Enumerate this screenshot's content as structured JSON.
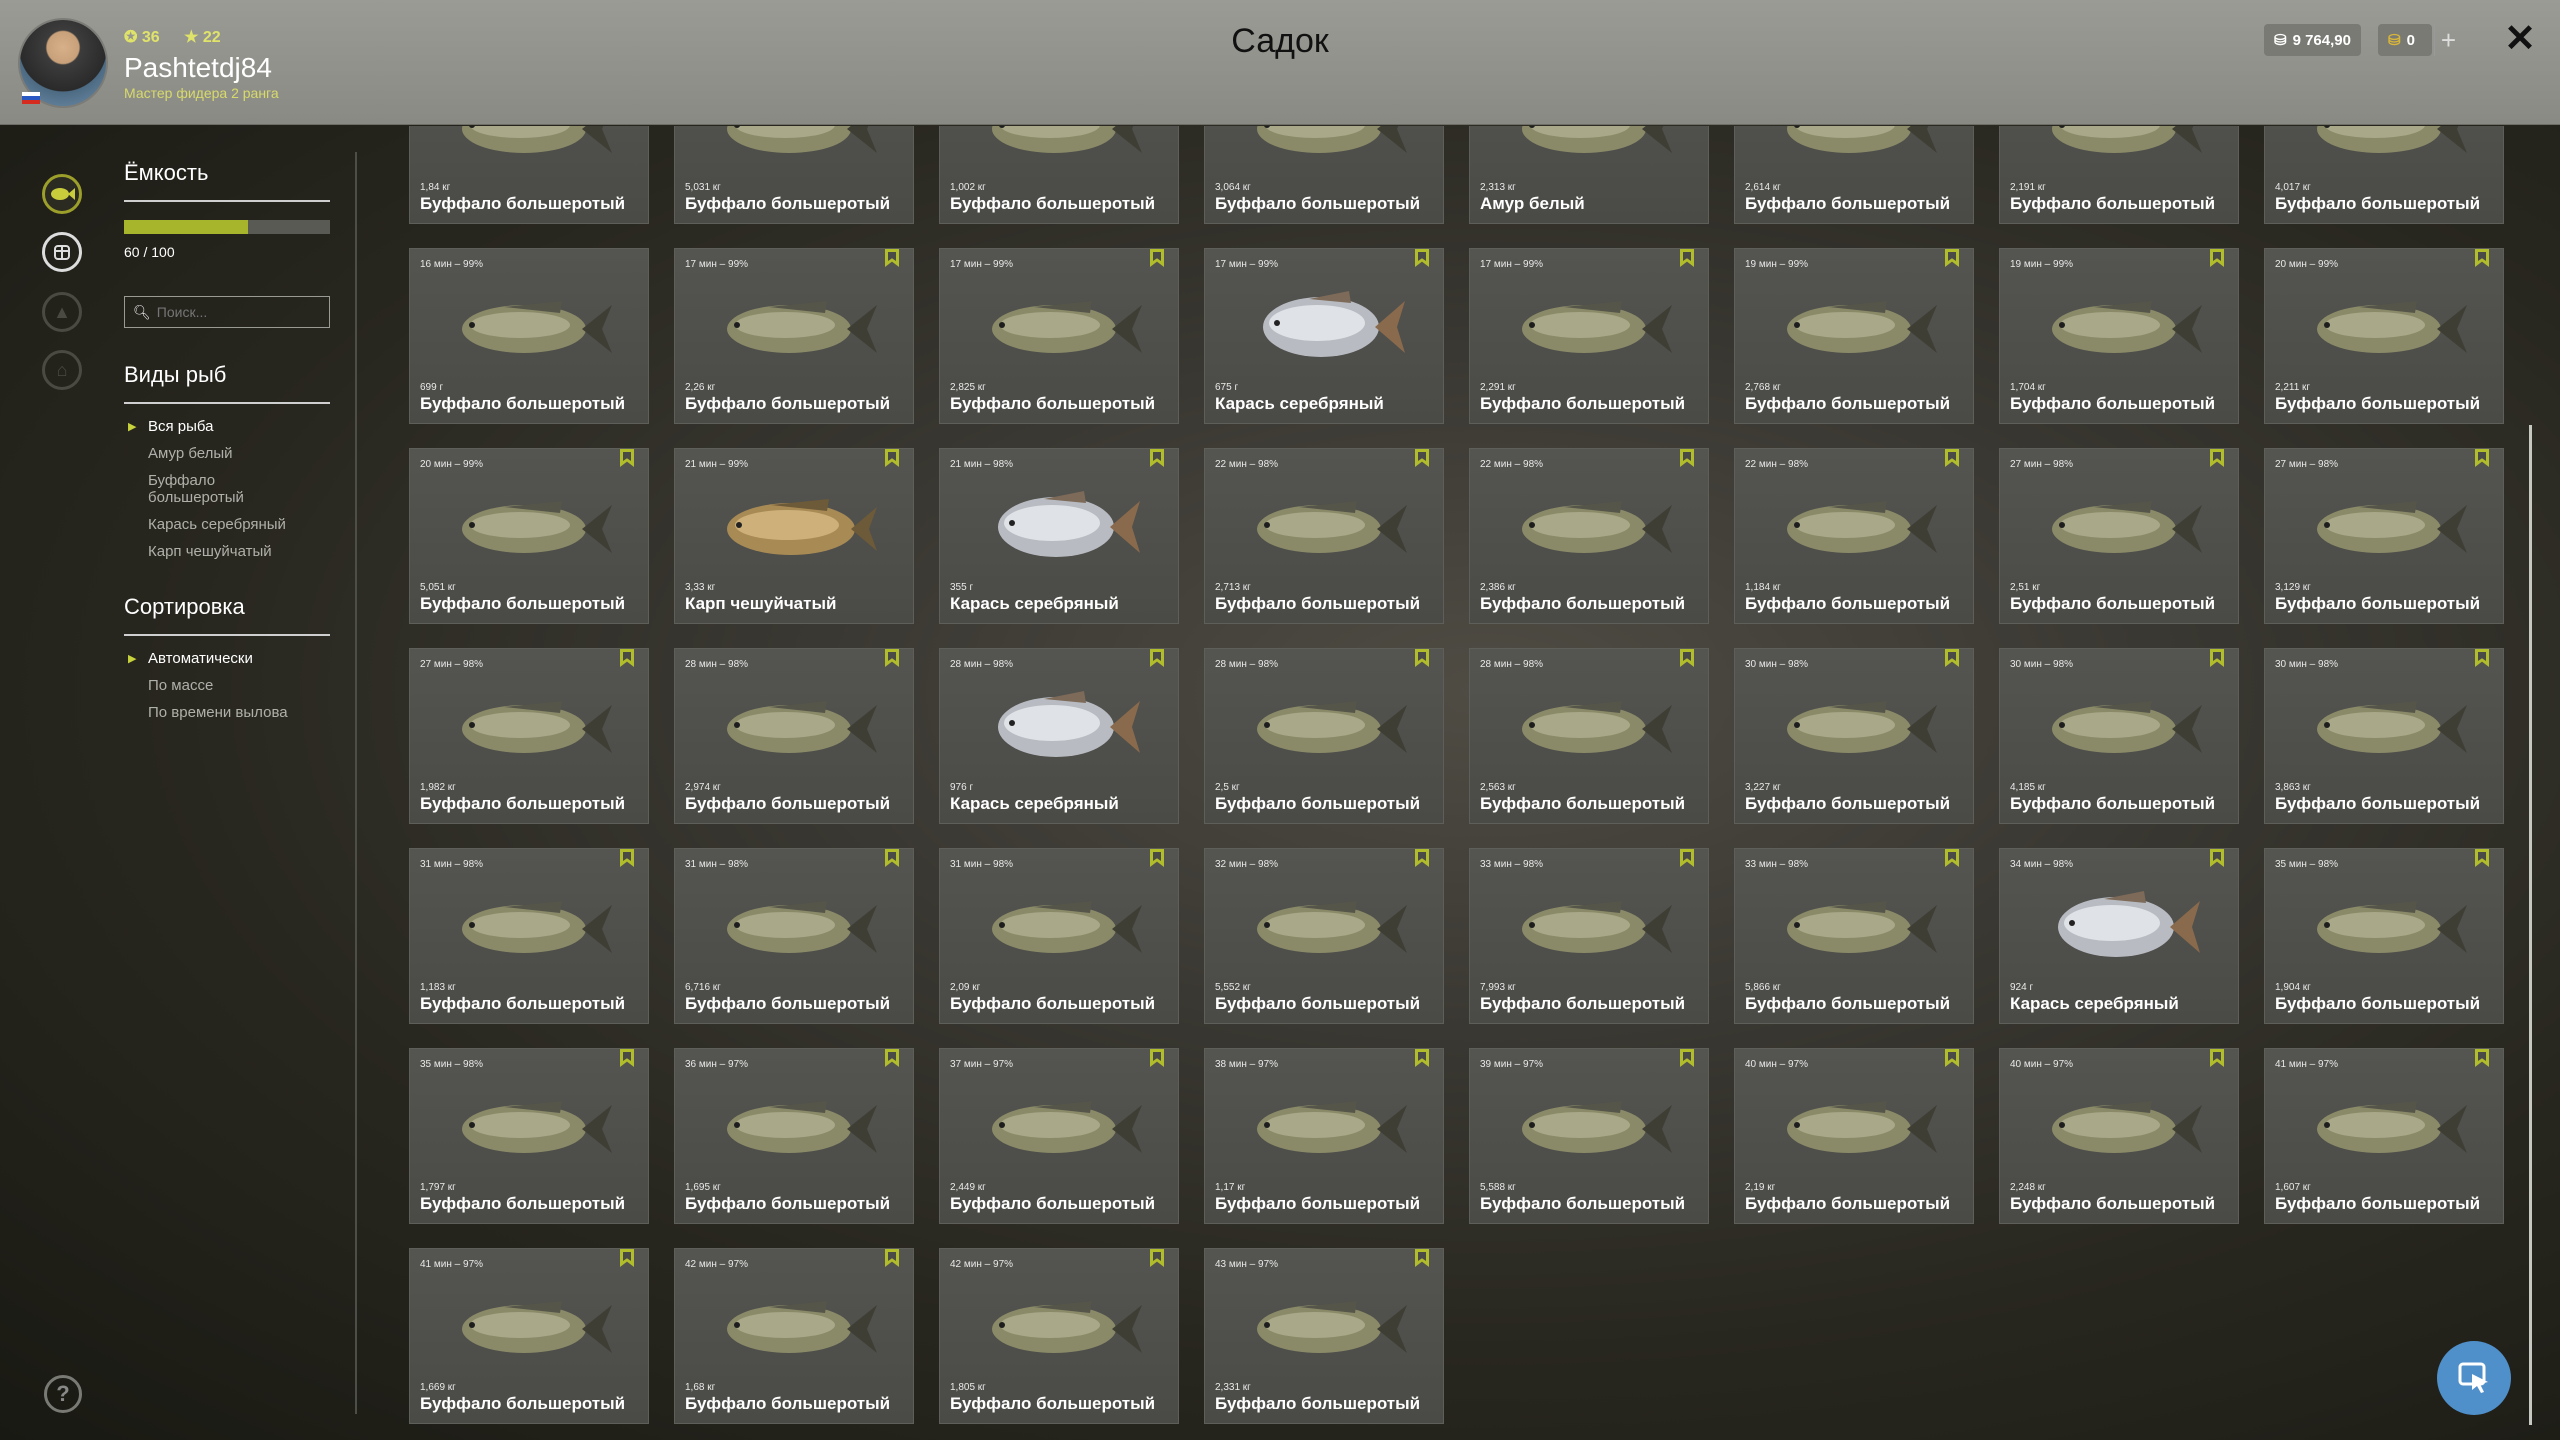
{
  "header": {
    "title": "Садок",
    "username": "Pashtetdj84",
    "rank": "Мастер фидера 2 ранга",
    "stat_a": "36",
    "stat_b": "22",
    "silver": "9 764,90",
    "gold": "0",
    "plus": "+",
    "close": "✕"
  },
  "sidebar": {
    "capacity_heading": "Ёмкость",
    "capacity_value": 60,
    "capacity_max": 100,
    "capacity_text": "60 / 100",
    "search_placeholder": "Поиск...",
    "species_heading": "Виды рыб",
    "species": [
      "Вся рыба",
      "Амур белый",
      "Буффало большеротый",
      "Карась серебряный",
      "Карп чешуйчатый"
    ],
    "sort_heading": "Сортировка",
    "sort": [
      "Автоматически",
      "По массе",
      "По времени вылова"
    ],
    "help": "?"
  },
  "colors": {
    "accent": "#a6b52c",
    "fab": "#4f8fca"
  },
  "fish": [
    {
      "time": "",
      "weight": "1,84 кг",
      "name": "Буффало большеротый",
      "type": "buffalo",
      "bm": false
    },
    {
      "time": "",
      "weight": "5,031 кг",
      "name": "Буффало большеротый",
      "type": "buffalo",
      "bm": false
    },
    {
      "time": "",
      "weight": "1,002 кг",
      "name": "Буффало большеротый",
      "type": "buffalo",
      "bm": false
    },
    {
      "time": "",
      "weight": "3,064 кг",
      "name": "Буффало большеротый",
      "type": "buffalo",
      "bm": false
    },
    {
      "time": "",
      "weight": "2,313 кг",
      "name": "Амур белый",
      "type": "buffalo",
      "bm": false
    },
    {
      "time": "",
      "weight": "2,614 кг",
      "name": "Буффало большеротый",
      "type": "buffalo",
      "bm": false
    },
    {
      "time": "",
      "weight": "2,191 кг",
      "name": "Буффало большеротый",
      "type": "buffalo",
      "bm": false
    },
    {
      "time": "",
      "weight": "4,017 кг",
      "name": "Буффало большеротый",
      "type": "buffalo",
      "bm": false
    },
    {
      "time": "16 мин – 99%",
      "weight": "699 г",
      "name": "Буффало большеротый",
      "type": "buffalo",
      "bm": false
    },
    {
      "time": "17 мин – 99%",
      "weight": "2,26 кг",
      "name": "Буффало большеротый",
      "type": "buffalo",
      "bm": true
    },
    {
      "time": "17 мин – 99%",
      "weight": "2,825 кг",
      "name": "Буффало большеротый",
      "type": "buffalo",
      "bm": true
    },
    {
      "time": "17 мин – 99%",
      "weight": "675 г",
      "name": "Карась серебряный",
      "type": "crucian",
      "bm": true
    },
    {
      "time": "17 мин – 99%",
      "weight": "2,291 кг",
      "name": "Буффало большеротый",
      "type": "buffalo",
      "bm": true
    },
    {
      "time": "19 мин – 99%",
      "weight": "2,768 кг",
      "name": "Буффало большеротый",
      "type": "buffalo",
      "bm": true
    },
    {
      "time": "19 мин – 99%",
      "weight": "1,704 кг",
      "name": "Буффало большеротый",
      "type": "buffalo",
      "bm": true
    },
    {
      "time": "20 мин – 99%",
      "weight": "2,211 кг",
      "name": "Буффало большеротый",
      "type": "buffalo",
      "bm": true
    },
    {
      "time": "20 мин – 99%",
      "weight": "5,051 кг",
      "name": "Буффало большеротый",
      "type": "buffalo",
      "bm": true
    },
    {
      "time": "21 мин – 99%",
      "weight": "3,33 кг",
      "name": "Карп чешуйчатый",
      "type": "carp",
      "bm": true
    },
    {
      "time": "21 мин – 98%",
      "weight": "355 г",
      "name": "Карась серебряный",
      "type": "crucian",
      "bm": true
    },
    {
      "time": "22 мин – 98%",
      "weight": "2,713 кг",
      "name": "Буффало большеротый",
      "type": "buffalo",
      "bm": true
    },
    {
      "time": "22 мин – 98%",
      "weight": "2,386 кг",
      "name": "Буффало большеротый",
      "type": "buffalo",
      "bm": true
    },
    {
      "time": "22 мин – 98%",
      "weight": "1,184 кг",
      "name": "Буффало большеротый",
      "type": "buffalo",
      "bm": true
    },
    {
      "time": "27 мин – 98%",
      "weight": "2,51 кг",
      "name": "Буффало большеротый",
      "type": "buffalo",
      "bm": true
    },
    {
      "time": "27 мин – 98%",
      "weight": "3,129 кг",
      "name": "Буффало большеротый",
      "type": "buffalo",
      "bm": true
    },
    {
      "time": "27 мин – 98%",
      "weight": "1,982 кг",
      "name": "Буффало большеротый",
      "type": "buffalo",
      "bm": true
    },
    {
      "time": "28 мин – 98%",
      "weight": "2,974 кг",
      "name": "Буффало большеротый",
      "type": "buffalo",
      "bm": true
    },
    {
      "time": "28 мин – 98%",
      "weight": "976 г",
      "name": "Карась серебряный",
      "type": "crucian",
      "bm": true
    },
    {
      "time": "28 мин – 98%",
      "weight": "2,5 кг",
      "name": "Буффало большеротый",
      "type": "buffalo",
      "bm": true
    },
    {
      "time": "28 мин – 98%",
      "weight": "2,563 кг",
      "name": "Буффало большеротый",
      "type": "buffalo",
      "bm": true
    },
    {
      "time": "30 мин – 98%",
      "weight": "3,227 кг",
      "name": "Буффало большеротый",
      "type": "buffalo",
      "bm": true
    },
    {
      "time": "30 мин – 98%",
      "weight": "4,185 кг",
      "name": "Буффало большеротый",
      "type": "buffalo",
      "bm": true
    },
    {
      "time": "30 мин – 98%",
      "weight": "3,863 кг",
      "name": "Буффало большеротый",
      "type": "buffalo",
      "bm": true
    },
    {
      "time": "31 мин – 98%",
      "weight": "1,183 кг",
      "name": "Буффало большеротый",
      "type": "buffalo",
      "bm": true
    },
    {
      "time": "31 мин – 98%",
      "weight": "6,716 кг",
      "name": "Буффало большеротый",
      "type": "buffalo",
      "bm": true
    },
    {
      "time": "31 мин – 98%",
      "weight": "2,09 кг",
      "name": "Буффало большеротый",
      "type": "buffalo",
      "bm": true
    },
    {
      "time": "32 мин – 98%",
      "weight": "5,552 кг",
      "name": "Буффало большеротый",
      "type": "buffalo",
      "bm": true
    },
    {
      "time": "33 мин – 98%",
      "weight": "7,993 кг",
      "name": "Буффало большеротый",
      "type": "buffalo",
      "bm": true
    },
    {
      "time": "33 мин – 98%",
      "weight": "5,866 кг",
      "name": "Буффало большеротый",
      "type": "buffalo",
      "bm": true
    },
    {
      "time": "34 мин – 98%",
      "weight": "924 г",
      "name": "Карась серебряный",
      "type": "crucian",
      "bm": true
    },
    {
      "time": "35 мин – 98%",
      "weight": "1,904 кг",
      "name": "Буффало большеротый",
      "type": "buffalo",
      "bm": true
    },
    {
      "time": "35 мин – 98%",
      "weight": "1,797 кг",
      "name": "Буффало большеротый",
      "type": "buffalo",
      "bm": true
    },
    {
      "time": "36 мин – 97%",
      "weight": "1,695 кг",
      "name": "Буффало большеротый",
      "type": "buffalo",
      "bm": true
    },
    {
      "time": "37 мин – 97%",
      "weight": "2,449 кг",
      "name": "Буффало большеротый",
      "type": "buffalo",
      "bm": true
    },
    {
      "time": "38 мин – 97%",
      "weight": "1,17 кг",
      "name": "Буффало большеротый",
      "type": "buffalo",
      "bm": true
    },
    {
      "time": "39 мин – 97%",
      "weight": "5,588 кг",
      "name": "Буффало большеротый",
      "type": "buffalo",
      "bm": true
    },
    {
      "time": "40 мин – 97%",
      "weight": "2,19 кг",
      "name": "Буффало большеротый",
      "type": "buffalo",
      "bm": true
    },
    {
      "time": "40 мин – 97%",
      "weight": "2,248 кг",
      "name": "Буффало большеротый",
      "type": "buffalo",
      "bm": true
    },
    {
      "time": "41 мин – 97%",
      "weight": "1,607 кг",
      "name": "Буффало большеротый",
      "type": "buffalo",
      "bm": true
    },
    {
      "time": "41 мин – 97%",
      "weight": "1,669 кг",
      "name": "Буффало большеротый",
      "type": "buffalo",
      "bm": true
    },
    {
      "time": "42 мин – 97%",
      "weight": "1,68 кг",
      "name": "Буффало большеротый",
      "type": "buffalo",
      "bm": true
    },
    {
      "time": "42 мин – 97%",
      "weight": "1,805 кг",
      "name": "Буффало большеротый",
      "type": "buffalo",
      "bm": true
    },
    {
      "time": "43 мин – 97%",
      "weight": "2,331 кг",
      "name": "Буффало большеротый",
      "type": "buffalo",
      "bm": true
    }
  ]
}
